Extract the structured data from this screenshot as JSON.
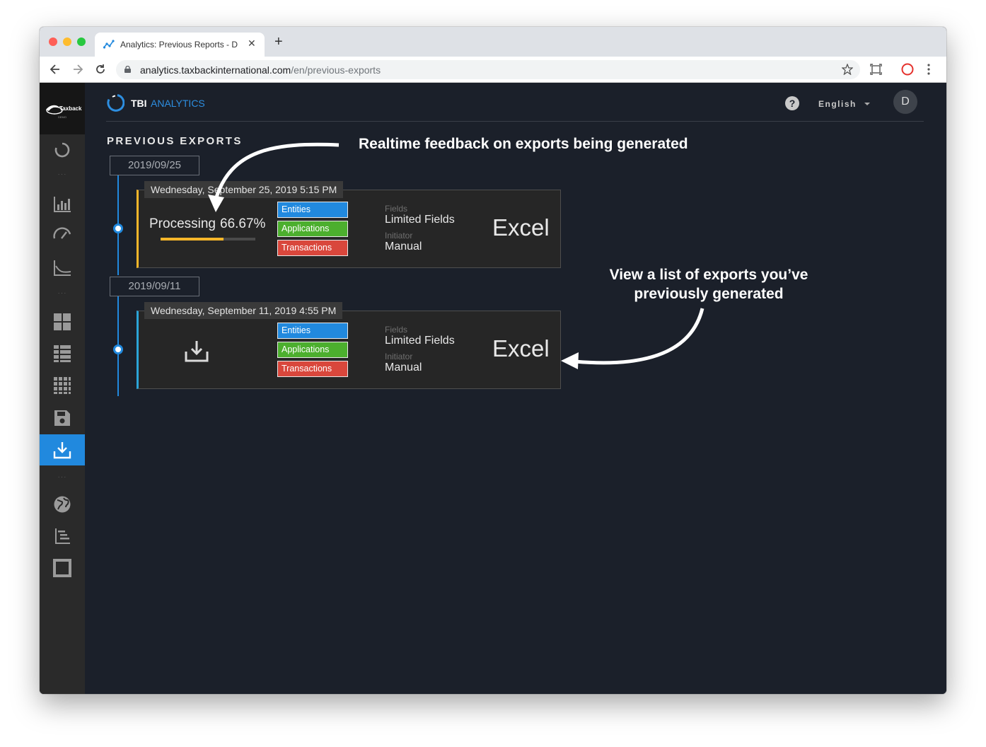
{
  "browser": {
    "tab_title": "Analytics: Previous Reports - D",
    "tab_close": "✕",
    "new_tab": "+",
    "url_domain": "analytics.taxbackinternational.com",
    "url_path": "/en/previous-exports"
  },
  "sidebar": {
    "logo_text": "Taxback",
    "logo_sub": "DEMO",
    "dots": "···"
  },
  "header": {
    "brand_tbi": "TBI",
    "brand_analytics": "ANALYTICS",
    "help": "?",
    "language": "English",
    "avatar_initial": "D"
  },
  "page": {
    "title": "PREVIOUS EXPORTS"
  },
  "exports": [
    {
      "group_date": "2019/09/25",
      "datetime": "Wednesday, September 25, 2019 5:15 PM",
      "status_label": "Processing",
      "progress_text": "66.67%",
      "progress": 0.6667,
      "tags": [
        "Entities",
        "Applications",
        "Transactions"
      ],
      "fields_label": "Fields",
      "fields_value": "Limited Fields",
      "initiator_label": "Initiator",
      "initiator_value": "Manual",
      "format": "Excel"
    },
    {
      "group_date": "2019/09/11",
      "datetime": "Wednesday, September 11, 2019 4:55 PM",
      "tags": [
        "Entities",
        "Applications",
        "Transactions"
      ],
      "fields_label": "Fields",
      "fields_value": "Limited Fields",
      "initiator_label": "Initiator",
      "initiator_value": "Manual",
      "format": "Excel"
    }
  ],
  "annotations": {
    "realtime": "Realtime feedback on exports being generated",
    "list_line1": "View a list of exports you’ve",
    "list_line2": "previously generated"
  },
  "colors": {
    "accent": "#2189de",
    "processing": "#f7b62a",
    "tag_blue": "#2189de",
    "tag_green": "#4caf2e",
    "tag_red": "#d9473c"
  }
}
